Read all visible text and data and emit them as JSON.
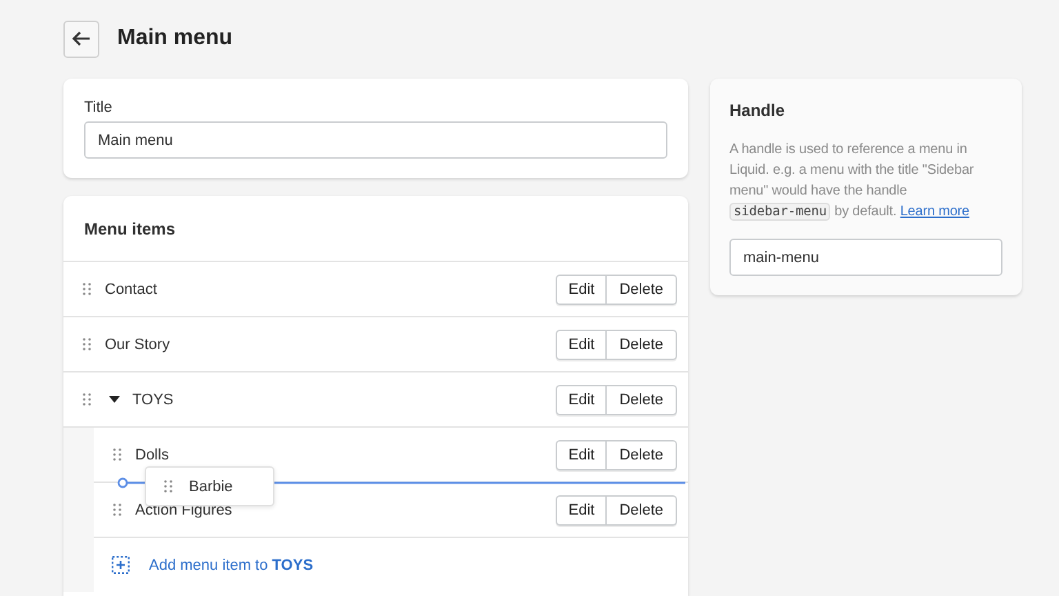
{
  "page": {
    "title": "Main menu"
  },
  "title_card": {
    "label": "Title",
    "value": "Main menu"
  },
  "menu": {
    "heading": "Menu items",
    "items": [
      {
        "label": "Contact",
        "actions": [
          "Edit",
          "Delete"
        ]
      },
      {
        "label": "Our Story",
        "actions": [
          "Edit",
          "Delete"
        ]
      },
      {
        "label": "TOYS",
        "expanded": true,
        "actions": [
          "Edit",
          "Delete"
        ],
        "children": [
          {
            "label": "Dolls",
            "actions": [
              "Edit",
              "Delete"
            ]
          },
          {
            "label": "Action Figures",
            "actions": [
              "Edit",
              "Delete"
            ]
          }
        ],
        "add_item": "Add menu item to **TOYS**"
      }
    ]
  },
  "drag": {
    "label": "Barbie"
  },
  "handle": {
    "heading": "Handle",
    "description_before": "A handle is used to reference a menu in Liquid. e.g. a menu with the title \"Sidebar menu\" would have the handle",
    "code": "sidebar-menu",
    "description_after": "by default.",
    "link": "Learn more",
    "value": "main-menu"
  }
}
